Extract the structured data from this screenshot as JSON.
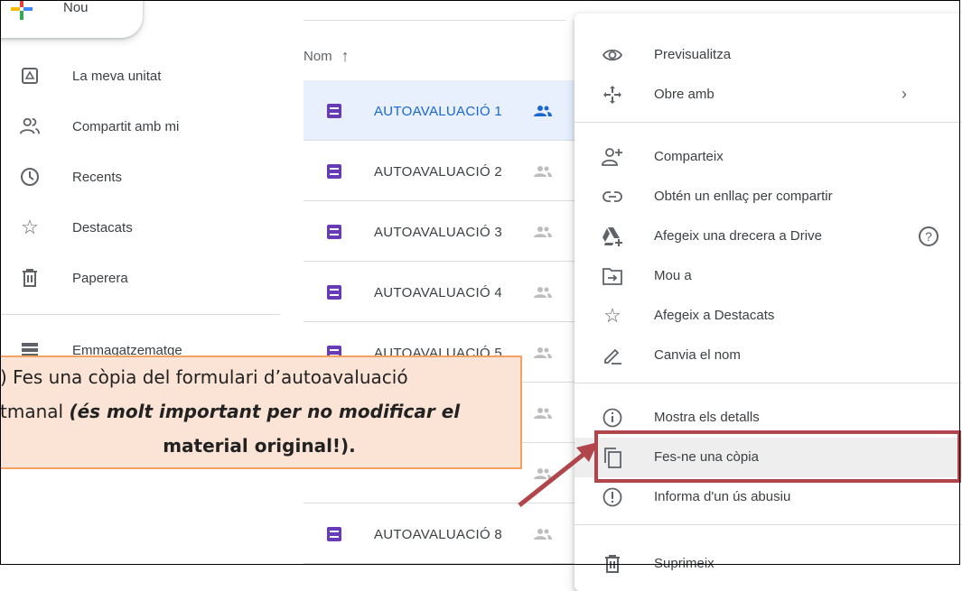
{
  "new_button": {
    "label": "Nou"
  },
  "sidebar": {
    "items": [
      {
        "label": "La meva unitat",
        "icon": "drive-icon"
      },
      {
        "label": "Compartit amb mi",
        "icon": "shared-people-icon"
      },
      {
        "label": "Recents",
        "icon": "clock-icon"
      },
      {
        "label": "Destacats",
        "icon": "star-icon"
      },
      {
        "label": "Paperera",
        "icon": "trash-icon"
      },
      {
        "label": "Emmagatzematge",
        "icon": "storage-icon"
      }
    ]
  },
  "file_list": {
    "sort_column": "Nom",
    "files": [
      {
        "name": "AUTOAVALUACIÓ 1"
      },
      {
        "name": "AUTOAVALUACIÓ 2"
      },
      {
        "name": "AUTOAVALUACIÓ 3"
      },
      {
        "name": "AUTOAVALUACIÓ 4"
      },
      {
        "name": "AUTOAVALUACIÓ 5"
      },
      {
        "name": "AUTOAVALUACIÓ 8"
      }
    ]
  },
  "context_menu": {
    "items": [
      {
        "label": "Previsualitza",
        "icon": "eye-icon"
      },
      {
        "label": "Obre amb",
        "icon": "open-with-icon",
        "submenu": true
      },
      {
        "label": "Comparteix",
        "icon": "person-add-icon"
      },
      {
        "label": "Obtén un enllaç per compartir",
        "icon": "link-icon"
      },
      {
        "label": "Afegeix una drecera a Drive",
        "icon": "drive-shortcut-icon"
      },
      {
        "label": "Mou a",
        "icon": "move-icon"
      },
      {
        "label": "Afegeix a Destacats",
        "icon": "star-outline-icon"
      },
      {
        "label": "Canvia el nom",
        "icon": "pencil-icon"
      },
      {
        "label": "Mostra els detalls",
        "icon": "info-icon"
      },
      {
        "label": "Fes-ne una còpia",
        "icon": "copy-icon"
      },
      {
        "label": "Informa d'un ús abusiu",
        "icon": "report-icon"
      },
      {
        "label": "Suprimeix",
        "icon": "trash-icon"
      }
    ]
  },
  "callout": {
    "line1": ") Fes una còpia del formulari d’autoavaluació",
    "line2_prefix": "tmanal ",
    "line2_bold": "(és molt important per no modificar el",
    "line3": "material original!)."
  },
  "colors": {
    "accent_blue": "#1967d2",
    "selected_row": "#e8f0fe",
    "forms_purple": "#673ab7",
    "highlight_red": "#b0454c",
    "callout_bg": "#fbe4d5",
    "callout_border": "#f4a261"
  }
}
